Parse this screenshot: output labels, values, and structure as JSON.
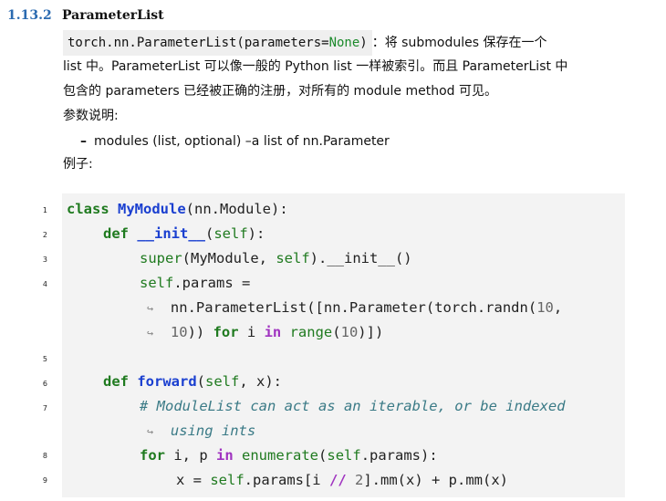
{
  "heading": {
    "number": "1.13.2",
    "title": "ParameterList"
  },
  "signature": {
    "prefix": "torch.nn.ParameterList(parameters=",
    "default": "None",
    "suffix": ")"
  },
  "intro": {
    "line1_tail": "：将 submodules 保存在一个",
    "line2": "list 中。ParameterList 可以像一般的 Python list 一样被索引。而且 ParameterList 中",
    "line3": "包含的 parameters 已经被正确的注册，对所有的 module method 可见。"
  },
  "params_label": "参数说明:",
  "bullet": {
    "dash": "–",
    "text": "modules (list, optional) –a list of nn.Parameter"
  },
  "example_label": "例子:",
  "code": {
    "line_numbers": [
      "1",
      "2",
      "3",
      "4",
      "5",
      "6",
      "7",
      "8",
      "9"
    ],
    "continuation_mark": "↪",
    "l1": {
      "kw": "class",
      "name": "MyModule",
      "rest": "(nn.Module):"
    },
    "l2": {
      "kw": "def",
      "name": "__init__",
      "open": "(",
      "self": "self",
      "close": "):"
    },
    "l3": {
      "func": "super",
      "a": "(MyModule, ",
      "self": "self",
      "b": ").__init__()"
    },
    "l4": {
      "self": "self",
      "rest": ".params ="
    },
    "l4c1": {
      "rest": "nn.ParameterList([nn.Parameter(torch.randn(",
      "n": "10",
      "comma": ","
    },
    "l4c2": {
      "n": "10",
      "a": ")) ",
      "kw": "for",
      "b": " i ",
      "in": "in",
      "sp": " ",
      "range": "range",
      "open": "(",
      "n2": "10",
      "close": ")])"
    },
    "l6": {
      "kw": "def",
      "name": "forward",
      "open": "(",
      "self": "self",
      "rest": ", x):"
    },
    "l7": {
      "comment": "# ModuleList can act as an iterable, or be indexed"
    },
    "l7c": {
      "comment": "using ints"
    },
    "l8": {
      "kw": "for",
      "a": " i, p ",
      "in": "in",
      "sp": " ",
      "func": "enumerate",
      "open": "(",
      "self": "self",
      "rest": ".params):"
    },
    "l9": {
      "a": "x = ",
      "self": "self",
      "b": ".params[i ",
      "op": "//",
      "sp": " ",
      "n": "2",
      "c": "].mm(x) + p.mm(x)"
    }
  }
}
